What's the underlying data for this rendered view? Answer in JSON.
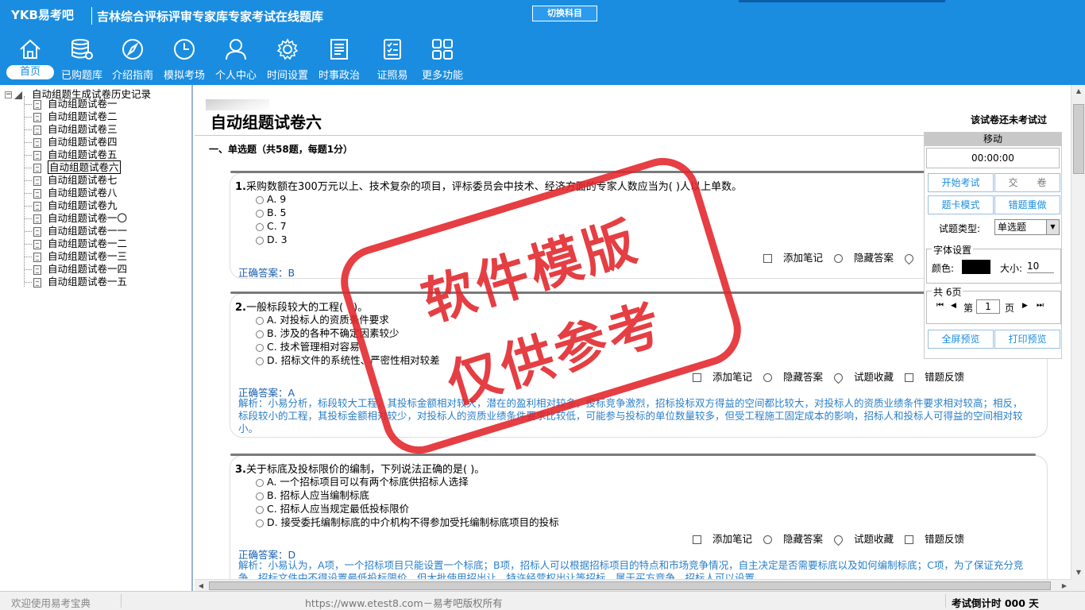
{
  "header": {
    "logo": "YKB易考吧",
    "title": "吉林综合评标评审专家库专家考试在线题库",
    "switch_subject": "切换科目"
  },
  "nav": [
    {
      "label": "首页",
      "icon": "home-icon"
    },
    {
      "label": "已购题库",
      "icon": "database-icon"
    },
    {
      "label": "介绍指南",
      "icon": "compass-icon"
    },
    {
      "label": "模拟考场",
      "icon": "clock-icon"
    },
    {
      "label": "个人中心",
      "icon": "user-icon"
    },
    {
      "label": "时间设置",
      "icon": "gear-icon"
    },
    {
      "label": "时事政治",
      "icon": "newspaper-icon"
    },
    {
      "label": "证照易",
      "icon": "checklist-icon"
    },
    {
      "label": "更多功能",
      "icon": "grid-icon"
    }
  ],
  "tree": {
    "root": "自动组题生成试卷历史记录",
    "items": [
      "自动组题试卷一",
      "自动组题试卷二",
      "自动组题试卷三",
      "自动组题试卷四",
      "自动组题试卷五",
      "自动组题试卷六",
      "自动组题试卷七",
      "自动组题试卷八",
      "自动组题试卷九",
      "自动组题试卷一〇",
      "自动组题试卷一一",
      "自动组题试卷一二",
      "自动组题试卷一三",
      "自动组题试卷一四",
      "自动组题试卷一五"
    ],
    "selected_index": 5
  },
  "paper": {
    "title": "自动组题试卷六",
    "status": "该试卷还未考试过",
    "section": "一、单选题（共58题，每题1分）"
  },
  "questions": [
    {
      "num": "1.",
      "text": "采购数额在300万元以上、技术复杂的项目，评标委员会中技术、经济方面的专家人数应当为( )人以上单数。",
      "options": [
        "A. 9",
        "B. 5",
        "C. 7",
        "D. 3"
      ],
      "answer": "正确答案：B",
      "analysis": ""
    },
    {
      "num": "2.",
      "text": "一般标段较大的工程(　)。",
      "options": [
        "A. 对投标人的资质条件要求",
        "B. 涉及的各种不确定因素较少",
        "C. 技术管理相对容易",
        "D. 招标文件的系统性、严密性相对较差"
      ],
      "answer": "正确答案：A",
      "analysis": "解析：小易分析，标段较大工程，其投标金额相对较大，潜在的盈利相对较多，投标竞争激烈，招标投标双方得益的空间都比较大，对投标人的资质业绩条件要求相对较高；相反，标段较小的工程，其投标金额相对较少，对投标人的资质业绩条件要求比较低，可能参与投标的单位数量较多，但受工程施工固定成本的影响，招标人和投标人可得益的空间相对较小。"
    },
    {
      "num": "3.",
      "text": "关于标底及投标限价的编制，下列说法正确的是( )。",
      "options": [
        "A. 一个招标项目可以有两个标底供招标人选择",
        "B. 招标人应当编制标底",
        "C. 招标人应当规定最低投标限价",
        "D. 接受委托编制标底的中介机构不得参加受托编制标底项目的投标"
      ],
      "answer": "正确答案：D",
      "analysis": "解析：小易认为，A项，一个招标项目只能设置一个标底；B项，招标人可以根据招标项目的特点和市场竞争情况，自主决定是否需要标底以及如何编制标底；C项，为了保证充分竞争，招标文件中不得设置最低投标限价，但大批使用招出让，特许经营权出让等招标，属于买方竞争，招标人可以设置"
    }
  ],
  "actions": {
    "note": "添加笔记",
    "hide": "隐藏答案",
    "fav": "试题收藏",
    "report": "错题反馈"
  },
  "control": {
    "move": "移动",
    "timer": "00:00:00",
    "start": "开始考试",
    "submit": "交　　卷",
    "card_mode": "题卡模式",
    "redo_wrong": "错题重做",
    "type_label": "试题类型:",
    "type_value": "单选题",
    "font_legend": "字体设置",
    "color_label": "颜色:",
    "size_label": "大小:",
    "size_value": "10",
    "pages_legend": "共 6页",
    "page_prefix": "第",
    "page_value": "1",
    "page_suffix": "页",
    "fullscreen": "全屏预览",
    "print": "打印预览",
    "first": "⏮",
    "prev": "◀",
    "next": "▶",
    "last": "⏭"
  },
  "status": {
    "welcome": "欢迎使用易考宝典",
    "copyright": "https://www.etest8.com－易考吧版权所有",
    "countdown": "考试倒计时 000 天"
  },
  "watermark": {
    "line1": "软件模版",
    "line2": "仅供参考"
  },
  "colors": {
    "header_bg": "#1a8de0",
    "answer_text": "#1a5fb0",
    "analysis_text": "#2a7fc9",
    "stamp_red": "#e2242a"
  }
}
